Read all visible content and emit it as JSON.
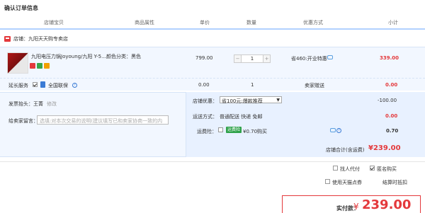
{
  "title": "确认订单信息",
  "columns": [
    "店铺宝贝",
    "商品属性",
    "单价",
    "数量",
    "优惠方式",
    "小计"
  ],
  "shop_label": "店铺：九阳天天购专卖店",
  "item": {
    "name": "九阳电压力锅Joyoung/九阳 Y-5...",
    "attr": "颜色分类：黑色",
    "price": "799.00",
    "qty": "1",
    "discount": "省460:开业特惠",
    "subtotal": "339.00"
  },
  "service": {
    "label": "延长服务",
    "option": "全国联保",
    "price": "0.00",
    "qty": "1",
    "shop_gift": "卖家赠送",
    "subtotal": "0.00"
  },
  "invoice": {
    "label": "发票抬头：",
    "value": "王菁",
    "edit": "修改"
  },
  "seller_msg": {
    "label": "给卖家留言：",
    "placeholder": "选填:对本次交易的说明(建议填写已和卖家协商一致的内容)"
  },
  "shop_discount": {
    "label": "店铺优惠：",
    "selected": "省100元:爆款推荐",
    "amount": "-100.00"
  },
  "shipping": {
    "label": "运送方式：",
    "value": "普通配送 快递 免邮",
    "amount": "0.00"
  },
  "insurance": {
    "label": "运费险：",
    "badge": "运费险",
    "text": "¥0.70购买",
    "amount": "0.70"
  },
  "shop_total": {
    "label": "店铺合计(含运费)",
    "amount": "¥239.00"
  },
  "options": {
    "proxy_pay": "找人代付",
    "anonymous": "匿名购买",
    "tmall_points": "使用天猫点券",
    "use_at_checkout": "结算时抵扣"
  },
  "pay": {
    "label": "实付款：",
    "currency": "¥",
    "amount": "239.00"
  },
  "colors": {
    "accent": "#e4393c",
    "header_border": "#b2d1ff",
    "row_bg": "#f2f7ff",
    "link": "#3a7bd5"
  }
}
